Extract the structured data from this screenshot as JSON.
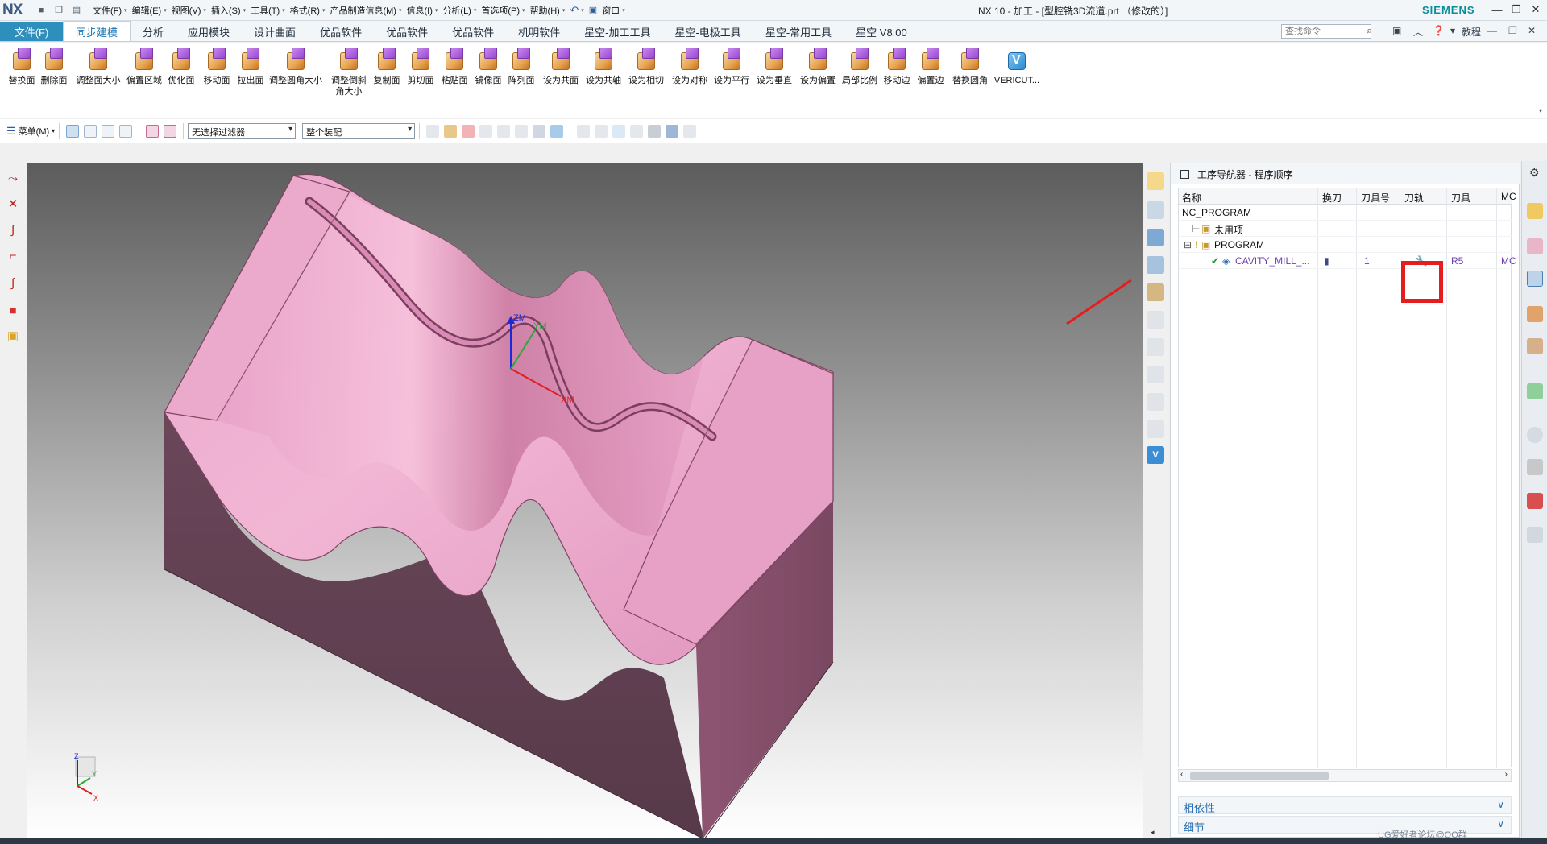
{
  "app": {
    "logo": "NX",
    "window_title": "NX 10 - 加工 - [型腔铣3D流道.prt （修改的）]",
    "brand": "SIEMENS"
  },
  "main_menu": [
    "文件(F)",
    "编辑(E)",
    "视图(V)",
    "插入(S)",
    "工具(T)",
    "格式(R)",
    "产品制造信息(M)",
    "信息(I)",
    "分析(L)",
    "首选项(P)",
    "帮助(H)"
  ],
  "window_menu": "窗口",
  "tabs": [
    "文件(F)",
    "同步建模",
    "分析",
    "应用模块",
    "设计曲面",
    "优品软件",
    "优品软件",
    "优品软件",
    "机明软件",
    "星空-加工工具",
    "星空-电极工具",
    "星空-常用工具",
    "星空 V8.00"
  ],
  "active_tab": "同步建模",
  "search": {
    "placeholder": "查找命令"
  },
  "help_label": "教程",
  "ribbon_buttons": [
    "替换面",
    "删除面",
    "调整面大小",
    "偏置区域",
    "优化面",
    "移动面",
    "拉出面",
    "调整圆角大小",
    "调整倒斜角大小",
    "复制面",
    "剪切面",
    "粘贴面",
    "镜像面",
    "阵列面",
    "设为共面",
    "设为共轴",
    "设为相切",
    "设为对称",
    "设为平行",
    "设为垂直",
    "设为偏置",
    "局部比例",
    "移动边",
    "偏置边",
    "替换圆角",
    "VERICUT..."
  ],
  "cmdbar": {
    "menu_label": "菜单(M)",
    "filter_value": "无选择过滤器",
    "assembly_value": "整个装配"
  },
  "viewport": {
    "csys_labels": [
      "ZM",
      "YM",
      "XM"
    ],
    "triad_labels": [
      "Z",
      "Y",
      "X"
    ],
    "colors": {
      "part_top": "#e7a0c8",
      "part_side": "#5a3a4e",
      "highlight_slot": "#c0508f"
    }
  },
  "navigator": {
    "title": "工序导航器 - 程序顺序",
    "columns": [
      "名称",
      "换刀",
      "刀具号",
      "刀轨",
      "刀具",
      "MC"
    ],
    "rows": [
      {
        "name": "NC_PROGRAM",
        "tool_change": "",
        "tool_no": "",
        "path": "",
        "tool": "",
        "mc": ""
      },
      {
        "name": "未用项",
        "tool_change": "",
        "tool_no": "",
        "path": "",
        "tool": "",
        "mc": ""
      },
      {
        "name": "PROGRAM",
        "tool_change": "",
        "tool_no": "",
        "path": "",
        "tool": "",
        "mc": ""
      },
      {
        "name": "CAVITY_MILL_...",
        "tool_change": "",
        "tool_no": "1",
        "path": "wrench-icon",
        "tool": "R5",
        "mc": "MC"
      }
    ],
    "accordion": [
      "相依性",
      "细节"
    ],
    "highlight_color": "#e41e1e"
  },
  "watermark": "UG爱好者论坛@QQ群"
}
